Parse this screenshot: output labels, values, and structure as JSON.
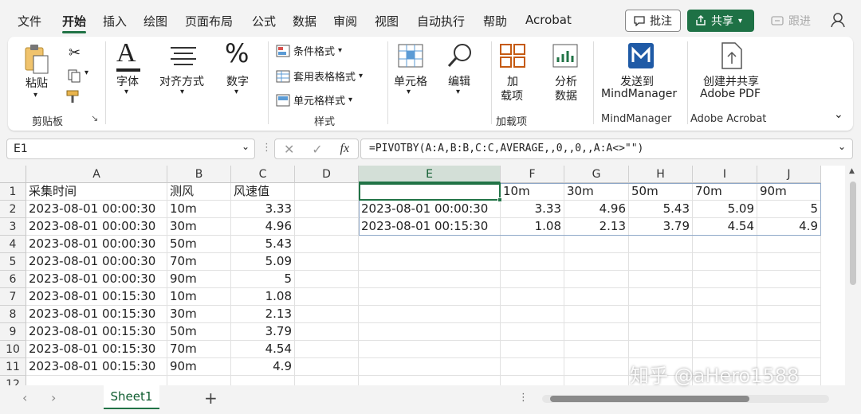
{
  "menu": [
    "文件",
    "开始",
    "插入",
    "绘图",
    "页面布局",
    "公式",
    "数据",
    "审阅",
    "视图",
    "自动执行",
    "帮助",
    "Acrobat"
  ],
  "top_buttons": {
    "comment": "批注",
    "share": "共享",
    "track": "跟进"
  },
  "ribbon": {
    "paste": "粘贴",
    "clipboard_group": "剪贴板",
    "font": "字体",
    "align": "对齐方式",
    "number": "数字",
    "cond_format": "条件格式",
    "table_format": "套用表格格式",
    "cell_style": "单元格样式",
    "styles_group": "样式",
    "cells": "单元格",
    "edit": "编辑",
    "addins_line1": "加",
    "addins_line2": "载项",
    "addins_group": "加载项",
    "analyze_line1": "分析",
    "analyze_line2": "数据",
    "mm_line1": "发送到",
    "mm_line2": "MindManager",
    "mm_group": "MindManager",
    "pdf_line1": "创建并共享",
    "pdf_line2": "Adobe PDF",
    "pdf_group": "Adobe Acrobat"
  },
  "formula_bar": {
    "name_box": "E1",
    "fx": "fx",
    "formula": "=PIVOTBY(A:A,B:B,C:C,AVERAGE,,0,,0,,A:A<>\"\")"
  },
  "columns": [
    "A",
    "B",
    "C",
    "D",
    "E",
    "F",
    "G",
    "H",
    "I",
    "J"
  ],
  "rows": [
    "1",
    "2",
    "3",
    "4",
    "5",
    "6",
    "7",
    "8",
    "9",
    "10",
    "11",
    "12"
  ],
  "source_table": {
    "headers": [
      "采集时间",
      "测风",
      "风速值"
    ],
    "rows": [
      [
        "2023-08-01 00:00:30",
        "10m",
        "3.33"
      ],
      [
        "2023-08-01 00:00:30",
        "30m",
        "4.96"
      ],
      [
        "2023-08-01 00:00:30",
        "50m",
        "5.43"
      ],
      [
        "2023-08-01 00:00:30",
        "70m",
        "5.09"
      ],
      [
        "2023-08-01 00:00:30",
        "90m",
        "5"
      ],
      [
        "2023-08-01 00:15:30",
        "10m",
        "1.08"
      ],
      [
        "2023-08-01 00:15:30",
        "30m",
        "2.13"
      ],
      [
        "2023-08-01 00:15:30",
        "50m",
        "3.79"
      ],
      [
        "2023-08-01 00:15:30",
        "70m",
        "4.54"
      ],
      [
        "2023-08-01 00:15:30",
        "90m",
        "4.9"
      ]
    ]
  },
  "pivot_table": {
    "headers": [
      "",
      "10m",
      "30m",
      "50m",
      "70m",
      "90m"
    ],
    "rows": [
      [
        "2023-08-01 00:00:30",
        "3.33",
        "4.96",
        "5.43",
        "5.09",
        "5"
      ],
      [
        "2023-08-01 00:15:30",
        "1.08",
        "2.13",
        "3.79",
        "4.54",
        "4.9"
      ]
    ]
  },
  "sheet_tab": "Sheet1",
  "watermark": "知乎 @aHero1588",
  "colors": {
    "accent": "#217346",
    "share": "#1e7145"
  }
}
